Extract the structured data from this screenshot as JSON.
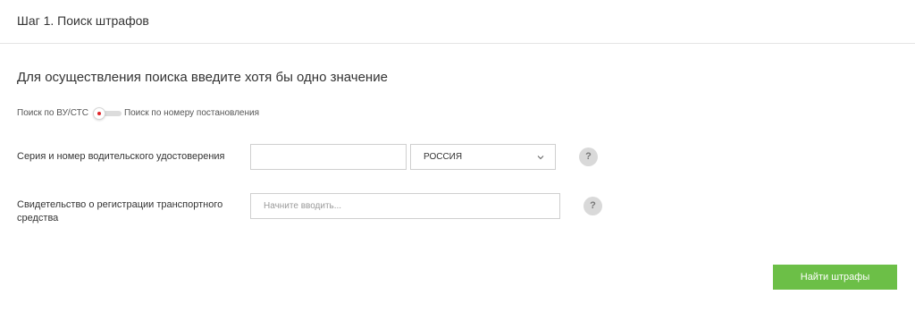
{
  "header": {
    "step_title": "Шаг 1. Поиск штрафов"
  },
  "instruction": "Для осуществления поиска введите хотя бы одно значение",
  "search_mode": {
    "left_label": "Поиск по ВУ/СТС",
    "right_label": "Поиск по номеру постановления",
    "selected": "left",
    "indicator_color": "#e0252a"
  },
  "fields": {
    "license": {
      "label": "Серия и номер водительского удостоверения",
      "value": "",
      "country_selected": "РОССИЯ",
      "help_icon": "?"
    },
    "vehicle_certificate": {
      "label": "Свидетельство о регистрации транспортного средства",
      "value": "",
      "placeholder": "Начните вводить...",
      "help_icon": "?"
    }
  },
  "actions": {
    "submit_label": "Найти штрафы",
    "submit_color": "#6cbf47"
  },
  "icons": {
    "country_dropdown": "chevron-down-icon",
    "help": "question-mark-icon",
    "toggle": "toggle-switch-icon"
  }
}
